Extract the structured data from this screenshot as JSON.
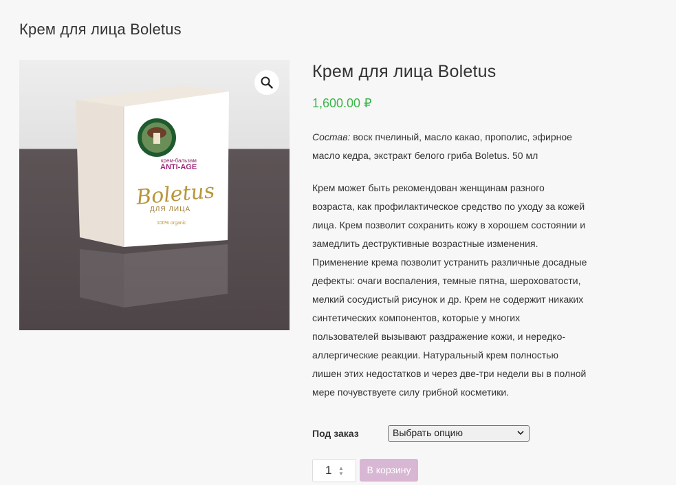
{
  "page": {
    "title": "Крем для лица Boletus"
  },
  "gallery": {
    "zoom_icon": "magnifier-icon",
    "packaging": {
      "label_small": "крем-бальзам",
      "label_antiage": "ANTI-AGE",
      "brand": "Boletus",
      "subtitle": "ДЛЯ ЛИЦА",
      "organic": "100% organic"
    }
  },
  "product": {
    "title": "Крем для лица Boletus",
    "price": "1,600.00 ₽",
    "composition_label": "Состав:",
    "composition_text": " воск пчелиный, масло какао, прополис, эфирное масло кедра, экстракт белого гриба Boletus. 50 мл",
    "description": "Крем может быть рекомендован  женщинам разного возраста,  как профилактическое средство по уходу за кожей лица. Крем позволит сохранить кожу в хорошем состоянии и замедлить деструктивные возрастные изменения. Применение крема позволит устранить различные досадные дефекты: очаги воспаления, темные пятна, шероховатости, мелкий сосудистый рисунок и др.  Крем не содержит никаких синтетических компонентов, которые у многих пользователей вызывают раздражение кожи, и нередко- аллергические реакции. Натуральный крем полностью лишен этих недостатков и через две-три недели вы в полной мере почувствуете силу грибной косметики."
  },
  "variation": {
    "label": "Под заказ",
    "selected": "Выбрать опцию"
  },
  "cart": {
    "quantity": "1",
    "add_label": "В корзину"
  },
  "colors": {
    "price": "#3bb54a",
    "button": "#d8b7d4"
  }
}
